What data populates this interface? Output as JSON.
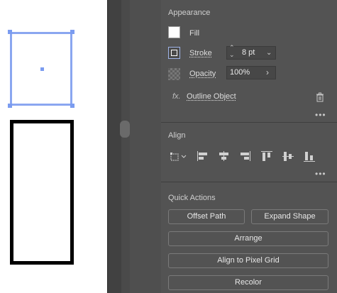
{
  "appearance": {
    "title": "Appearance",
    "fill_label": "Fill",
    "stroke_label": "Stroke",
    "stroke_weight": "8 pt",
    "opacity_label": "Opacity",
    "opacity_value": "100%",
    "fx_label": "fx.",
    "effect_label": "Outline Object",
    "more_dots": "•••"
  },
  "align": {
    "title": "Align",
    "icons": [
      "align-to-icon",
      "align-left-icon",
      "align-horizontal-center-icon",
      "align-right-icon",
      "align-top-icon",
      "align-vertical-center-icon",
      "align-bottom-icon"
    ],
    "more_dots": "•••"
  },
  "quick_actions": {
    "title": "Quick Actions",
    "offset_path": "Offset Path",
    "expand_shape": "Expand Shape",
    "arrange": "Arrange",
    "align_pixel_grid": "Align to Pixel Grid",
    "recolor": "Recolor"
  },
  "colors": {
    "selection": "#7b9cf0",
    "panel_bg": "#535353"
  }
}
